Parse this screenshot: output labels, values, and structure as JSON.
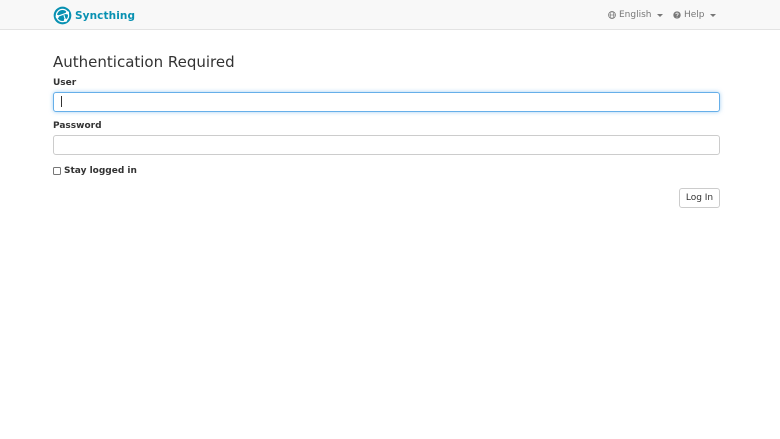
{
  "navbar": {
    "brand": "Syncthing",
    "language_label": "English",
    "help_label": "Help",
    "icons": {
      "brand": "syncthing-logo",
      "language": "globe-icon",
      "help": "question-circle-icon",
      "dropdown": "caret-down-icon"
    }
  },
  "colors": {
    "brand": "#0891b2",
    "focus": "#66afe9"
  },
  "login": {
    "title": "Authentication Required",
    "user_label": "User",
    "user_value": "",
    "password_label": "Password",
    "password_value": "",
    "stay_logged_in_label": "Stay logged in",
    "stay_logged_in_checked": false,
    "login_button_label": "Log In"
  }
}
